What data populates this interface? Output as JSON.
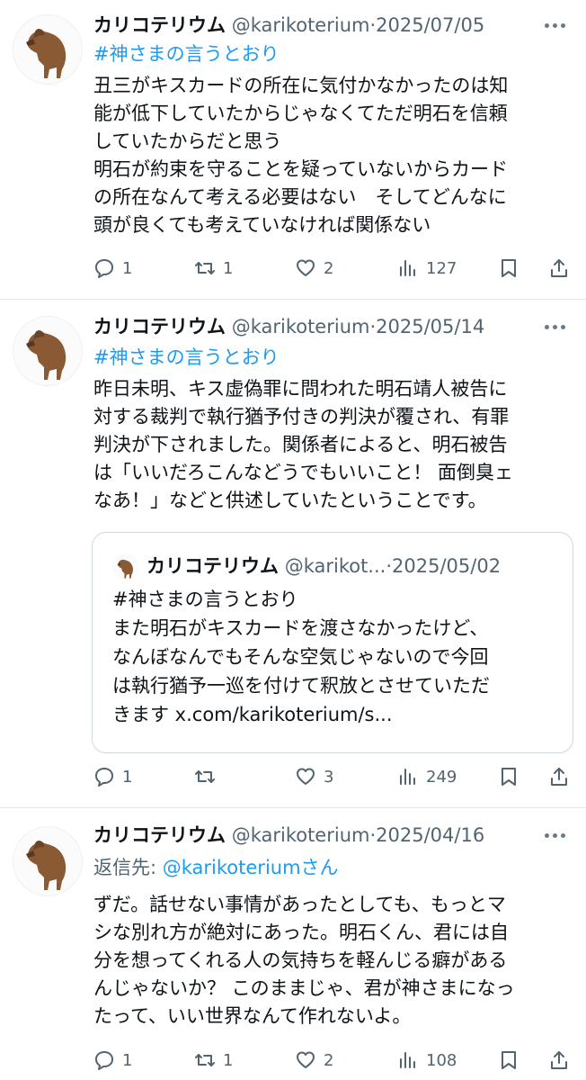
{
  "tweets": [
    {
      "author": "カリコテリウム",
      "handle": "@karikoterium",
      "date": "2025/07/05",
      "hashtag": "#神さまの言うとおり",
      "lines": [
        "丑三がキスカードの所在に気付かなかったのは知",
        "能が低下していたからじゃなくてただ明石を信頼",
        "していたからだと思う",
        "明石が約束を守ることを疑っていないからカード",
        "の所在なんて考える必要はない　そしてどんなに",
        "頭が良くても考えていなければ関係ない"
      ],
      "replies": "1",
      "retweets": "1",
      "likes": "2",
      "views": "127"
    },
    {
      "author": "カリコテリウム",
      "handle": "@karikoterium",
      "date": "2025/05/14",
      "hashtag": "#神さまの言うとおり",
      "lines": [
        "昨日未明、キス虚偽罪に問われた明石靖人被告に",
        "対する裁判で執行猶予付きの判決が覆され、有罪",
        "判決が下されました。関係者によると、明石被告",
        "は「いいだろこんなどうでもいいこと！ 面倒臭ェ",
        "なあ！」などと供述していたということです。"
      ],
      "quote": {
        "author": "カリコテリウム",
        "handle": "@karikot...",
        "date": "2025/05/02",
        "lines": [
          "#神さまの言うとおり",
          "また明石がキスカードを渡さなかったけど、",
          "なんぼなんでもそんな空気じゃないので今回",
          "は執行猶予一巡を付けて釈放とさせていただ",
          "きます x.com/karikoterium/s..."
        ]
      },
      "replies": "1",
      "retweets": "",
      "likes": "3",
      "views": "249"
    },
    {
      "author": "カリコテリウム",
      "handle": "@karikoterium",
      "date": "2025/04/16",
      "reply_prefix": "返信先: ",
      "reply_handle": "@karikoterium",
      "reply_suffix": "さん",
      "lines": [
        "ずだ。話せない事情があったとしても、もっとマ",
        "シな別れ方が絶対にあった。明石くん、君には自",
        "分を想ってくれる人の気持ちを軽んじる癖がある",
        "んじゃないか？ このままじゃ、君が神さまになっ",
        "たって、いい世界なんて作れないよ。"
      ],
      "replies": "1",
      "retweets": "1",
      "likes": "2",
      "views": "108"
    }
  ],
  "separator": "·",
  "colors": {
    "link": "#1d9bf0",
    "secondary": "#536471",
    "text": "#0f1419",
    "divider": "#e6e9eb"
  },
  "icons": [
    "reply-icon",
    "retweet-icon",
    "like-icon",
    "views-icon",
    "bookmark-icon",
    "share-icon",
    "more-icon",
    "avatar-icon"
  ]
}
